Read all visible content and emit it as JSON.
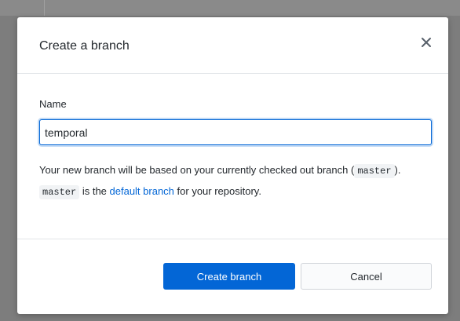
{
  "dialog": {
    "title": "Create a branch",
    "close_icon": "close-icon"
  },
  "form": {
    "name_label": "Name",
    "name_value": "temporal"
  },
  "description": {
    "part1": "Your new branch will be based on your currently checked out branch (",
    "current_branch": "master",
    "part2": "). ",
    "default_branch": "master",
    "part3": " is the ",
    "link_text": "default branch",
    "part4": " for your repository."
  },
  "footer": {
    "create_label": "Create branch",
    "cancel_label": "Cancel"
  },
  "colors": {
    "accent": "#0366d6",
    "backdrop": "#7d7d7d"
  }
}
